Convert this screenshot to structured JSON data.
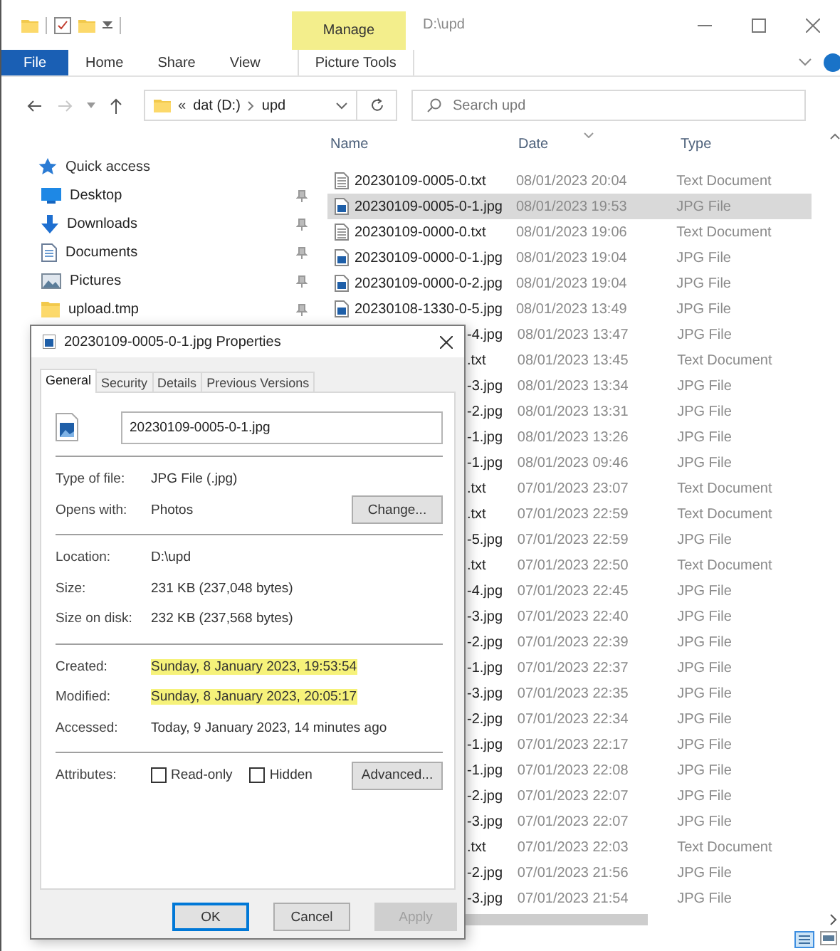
{
  "window": {
    "title": "D:\\upd",
    "context_tab": "Manage"
  },
  "ribbon": {
    "tabs": [
      {
        "label": "File",
        "kind": "file"
      },
      {
        "label": "Home",
        "kind": "tab"
      },
      {
        "label": "Share",
        "kind": "tab"
      },
      {
        "label": "View",
        "kind": "tab"
      },
      {
        "label": "Picture Tools",
        "kind": "context"
      }
    ]
  },
  "address_bar": {
    "overflow": "«",
    "segments": [
      "dat (D:)",
      "upd"
    ]
  },
  "search": {
    "placeholder": "Search upd"
  },
  "navigation": {
    "items": [
      {
        "label": "Quick access",
        "kind": "quick",
        "pinned": false
      },
      {
        "label": "Desktop",
        "kind": "desktop",
        "pinned": true
      },
      {
        "label": "Downloads",
        "kind": "downloads",
        "pinned": true
      },
      {
        "label": "Documents",
        "kind": "documents",
        "pinned": true
      },
      {
        "label": "Pictures",
        "kind": "pictures",
        "pinned": true
      },
      {
        "label": "upload.tmp",
        "kind": "folder",
        "pinned": true
      }
    ]
  },
  "file_list": {
    "columns": [
      "Name",
      "Date",
      "Type"
    ],
    "rows": [
      {
        "name": "20230109-0005-0.txt",
        "date": "08/01/2023 20:04",
        "type": "Text Document",
        "kind": "text",
        "selected": false
      },
      {
        "name": "20230109-0005-0-1.jpg",
        "date": "08/01/2023 19:53",
        "type": "JPG File",
        "kind": "image",
        "selected": true
      },
      {
        "name": "20230109-0000-0.txt",
        "date": "08/01/2023 19:06",
        "type": "Text Document",
        "kind": "text",
        "selected": false
      },
      {
        "name": "20230109-0000-0-1.jpg",
        "date": "08/01/2023 19:04",
        "type": "JPG File",
        "kind": "image",
        "selected": false
      },
      {
        "name": "20230109-0000-0-2.jpg",
        "date": "08/01/2023 19:04",
        "type": "JPG File",
        "kind": "image",
        "selected": false
      },
      {
        "name": "20230108-1330-0-5.jpg",
        "date": "08/01/2023 13:49",
        "type": "JPG File",
        "kind": "image",
        "selected": false
      },
      {
        "name": "-4.jpg",
        "date": "08/01/2023 13:47",
        "type": "JPG File",
        "selected": false
      },
      {
        "name": ".txt",
        "date": "08/01/2023 13:45",
        "type": "Text Document",
        "selected": false
      },
      {
        "name": "-3.jpg",
        "date": "08/01/2023 13:34",
        "type": "JPG File",
        "selected": false
      },
      {
        "name": "-2.jpg",
        "date": "08/01/2023 13:31",
        "type": "JPG File",
        "selected": false
      },
      {
        "name": "-1.jpg",
        "date": "08/01/2023 13:26",
        "type": "JPG File",
        "selected": false
      },
      {
        "name": "-1.jpg",
        "date": "08/01/2023 09:46",
        "type": "JPG File",
        "selected": false
      },
      {
        "name": ".txt",
        "date": "07/01/2023 23:07",
        "type": "Text Document",
        "selected": false
      },
      {
        "name": ".txt",
        "date": "07/01/2023 22:59",
        "type": "Text Document",
        "selected": false
      },
      {
        "name": "-5.jpg",
        "date": "07/01/2023 22:59",
        "type": "JPG File",
        "selected": false
      },
      {
        "name": ".txt",
        "date": "07/01/2023 22:50",
        "type": "Text Document",
        "selected": false
      },
      {
        "name": "-4.jpg",
        "date": "07/01/2023 22:45",
        "type": "JPG File",
        "selected": false
      },
      {
        "name": "-3.jpg",
        "date": "07/01/2023 22:40",
        "type": "JPG File",
        "selected": false
      },
      {
        "name": "-2.jpg",
        "date": "07/01/2023 22:39",
        "type": "JPG File",
        "selected": false
      },
      {
        "name": "-1.jpg",
        "date": "07/01/2023 22:37",
        "type": "JPG File",
        "selected": false
      },
      {
        "name": "-3.jpg",
        "date": "07/01/2023 22:35",
        "type": "JPG File",
        "selected": false
      },
      {
        "name": "-2.jpg",
        "date": "07/01/2023 22:34",
        "type": "JPG File",
        "selected": false
      },
      {
        "name": "-1.jpg",
        "date": "07/01/2023 22:17",
        "type": "JPG File",
        "selected": false
      },
      {
        "name": "-1.jpg",
        "date": "07/01/2023 22:08",
        "type": "JPG File",
        "selected": false
      },
      {
        "name": "-2.jpg",
        "date": "07/01/2023 22:07",
        "type": "JPG File",
        "selected": false
      },
      {
        "name": "-3.jpg",
        "date": "07/01/2023 22:07",
        "type": "JPG File",
        "selected": false
      },
      {
        "name": ".txt",
        "date": "07/01/2023 22:03",
        "type": "Text Document",
        "selected": false
      },
      {
        "name": "-2.jpg",
        "date": "07/01/2023 21:56",
        "type": "JPG File",
        "selected": false
      },
      {
        "name": "-3.jpg",
        "date": "07/01/2023 21:54",
        "type": "JPG File",
        "selected": false
      }
    ]
  },
  "properties_dialog": {
    "title": "20230109-0005-0-1.jpg Properties",
    "tabs": [
      {
        "label": "General",
        "selected": true
      },
      {
        "label": "Security",
        "selected": false
      },
      {
        "label": "Details",
        "selected": false
      },
      {
        "label": "Previous Versions",
        "selected": false
      }
    ],
    "file_name": "20230109-0005-0-1.jpg",
    "sections": [
      [
        {
          "label": "Type of file:",
          "value": "JPG File (.jpg)",
          "highlighted": false
        },
        {
          "label": "Opens with:",
          "value": "Photos",
          "highlighted": false,
          "button": "Change..."
        }
      ],
      [
        {
          "label": "Location:",
          "value": "D:\\upd",
          "highlighted": false
        },
        {
          "label": "Size:",
          "value": "231 KB (237,048 bytes)",
          "highlighted": false
        },
        {
          "label": "Size on disk:",
          "value": "232 KB (237,568 bytes)",
          "highlighted": false
        }
      ],
      [
        {
          "label": "Created:",
          "value": "Sunday, 8 January 2023, 19:53:54",
          "highlighted": true
        },
        {
          "label": "Modified:",
          "value": "Sunday, 8 January 2023, 20:05:17",
          "highlighted": true
        },
        {
          "label": "Accessed:",
          "value": "Today, 9 January 2023, 14 minutes ago",
          "highlighted": false
        }
      ]
    ],
    "attributes": {
      "label": "Attributes:",
      "checkboxes": [
        {
          "label": "Read-only",
          "checked": false
        },
        {
          "label": "Hidden",
          "checked": false
        }
      ],
      "button": "Advanced..."
    },
    "buttons": [
      {
        "label": "OK",
        "kind": "default",
        "disabled": false
      },
      {
        "label": "Cancel",
        "kind": "normal",
        "disabled": false
      },
      {
        "label": "Apply",
        "kind": "normal",
        "disabled": true
      }
    ]
  }
}
